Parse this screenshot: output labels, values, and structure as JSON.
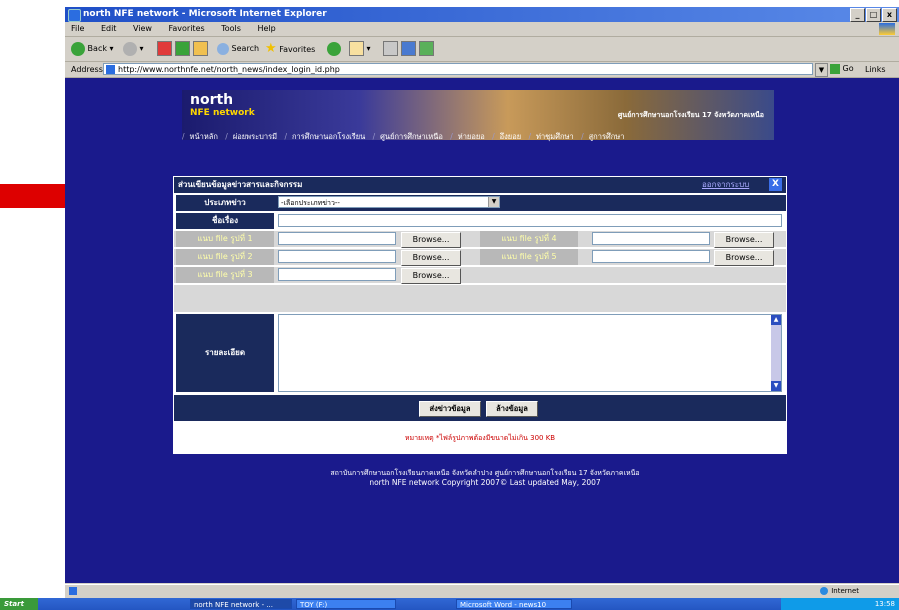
{
  "window": {
    "title": "north NFE network - Microsoft Internet Explorer",
    "controls": [
      "_",
      "□",
      "x"
    ]
  },
  "menu": [
    "File",
    "Edit",
    "View",
    "Favorites",
    "Tools",
    "Help"
  ],
  "toolbar": {
    "back": "Back",
    "search": "Search",
    "favorites": "Favorites"
  },
  "address": {
    "label": "Address",
    "url": "http://www.northnfe.net/north_news/index_login_id.php",
    "go": "Go",
    "links": "Links"
  },
  "site": {
    "logo_top": "north",
    "logo_bottom": "NFE network",
    "banner_caption": "ศูนย์การศึกษานอกโรงเรียน 17 จังหวัดภาคเหนือ",
    "nav": [
      "หน้าหลัก",
      "ผ่อยพระบารมี",
      "การศึกษานอกโรงเรียน",
      "ศูนย์การศึกษาเหนือ",
      "ห่ายอยอ",
      "อึงยอย",
      "ท่าชุมศึกษา",
      "สูการศึกษา"
    ]
  },
  "form": {
    "title": "ส่วนเขียนข้อมูลข่าวสารและกิจกรรม",
    "logout": "ออกจากระบบ",
    "close": "X",
    "type_label": "ประเภทข่าว",
    "type_value": "-เลือกประเภทข่าว--",
    "subject_label": "ชื่อเรื่อง",
    "file_label_1": "แนบ file รูปที่ 1",
    "file_label_2": "แนบ file รูปที่ 2",
    "file_label_3": "แนบ file รูปที่ 3",
    "file_label_4": "แนบ file รูปที่ 4",
    "file_label_5": "แนบ file รูปที่ 5",
    "browse": "Browse...",
    "detail_label": "รายละเอียด",
    "submit": "ส่งข่าวข้อมูล",
    "reset": "ล้างข้อมูล",
    "note": "หมายเหตุ *ไฟล์รูปภาพต้องมีขนาดไม่เกิน 300 KB"
  },
  "footer": {
    "line1": "สถาบันการศึกษานอกโรงเรียนภาคเหนือ จังหวัดลำปาง ศูนย์การศึกษานอกโรงเรียน 17 จังหวัดภาคเหนือ",
    "line2": "north NFE network Copyright 2007© Last updated May, 2007"
  },
  "statusbar": {
    "zone": "Internet"
  },
  "taskbar": {
    "start": "Start",
    "tasks": [
      "north NFE network - ...",
      "TOY (F:)",
      "Microsoft Word - news10"
    ],
    "clock": "13:58"
  }
}
